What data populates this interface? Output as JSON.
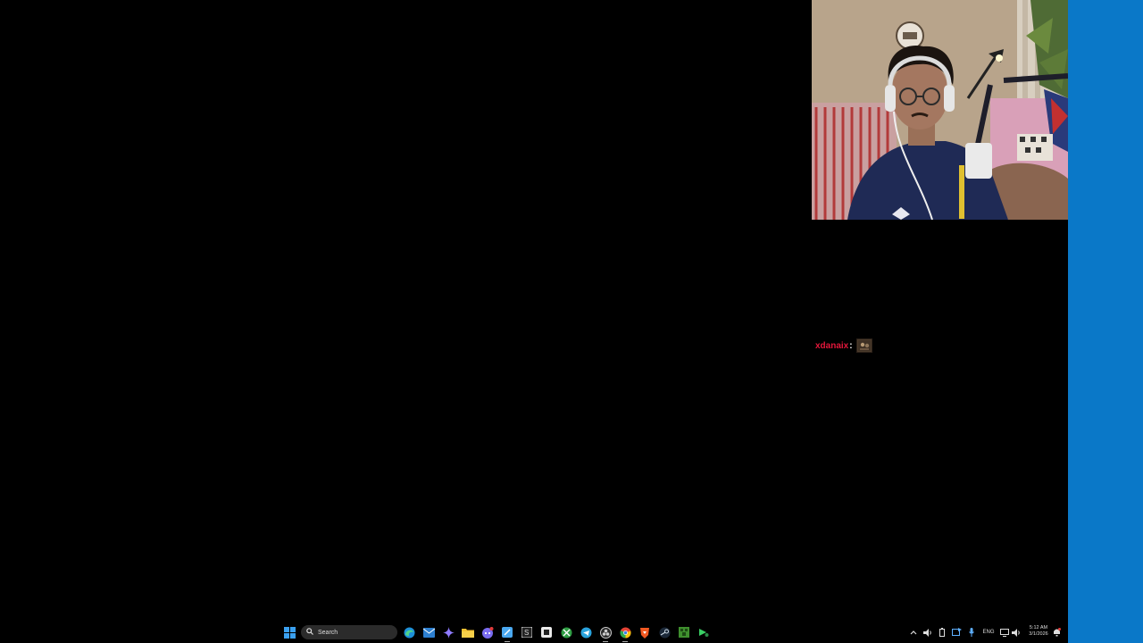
{
  "chat": {
    "username": "xdanaix",
    "separator": ":",
    "emote_icon": "emote-image"
  },
  "taskbar": {
    "search_label": "Search",
    "language": "ENG",
    "time": "5:12 AM",
    "date": "3/1/2026",
    "pinned_icons": [
      "windows-start-icon",
      "edge-icon",
      "mail-icon",
      "gemini-icon",
      "discord-icon",
      "files-icon",
      "notes-icon",
      "app-icon",
      "ms-store-icon",
      "xbox-icon",
      "telegram-icon",
      "obs-icon",
      "chrome-icon",
      "brave-icon",
      "steam-icon",
      "minecraft-icon",
      "spotify-icon"
    ],
    "tray_icons": [
      "chevron-up-icon",
      "volume-icon",
      "battery-icon",
      "mic-icon",
      "sync-icon",
      "language-indicator",
      "network-icon",
      "speaker-icon",
      "notification-icon"
    ]
  },
  "colors": {
    "desktop_bg": "#000000",
    "right_strip": "#0a78c8",
    "chat_username": "#e3173b"
  }
}
